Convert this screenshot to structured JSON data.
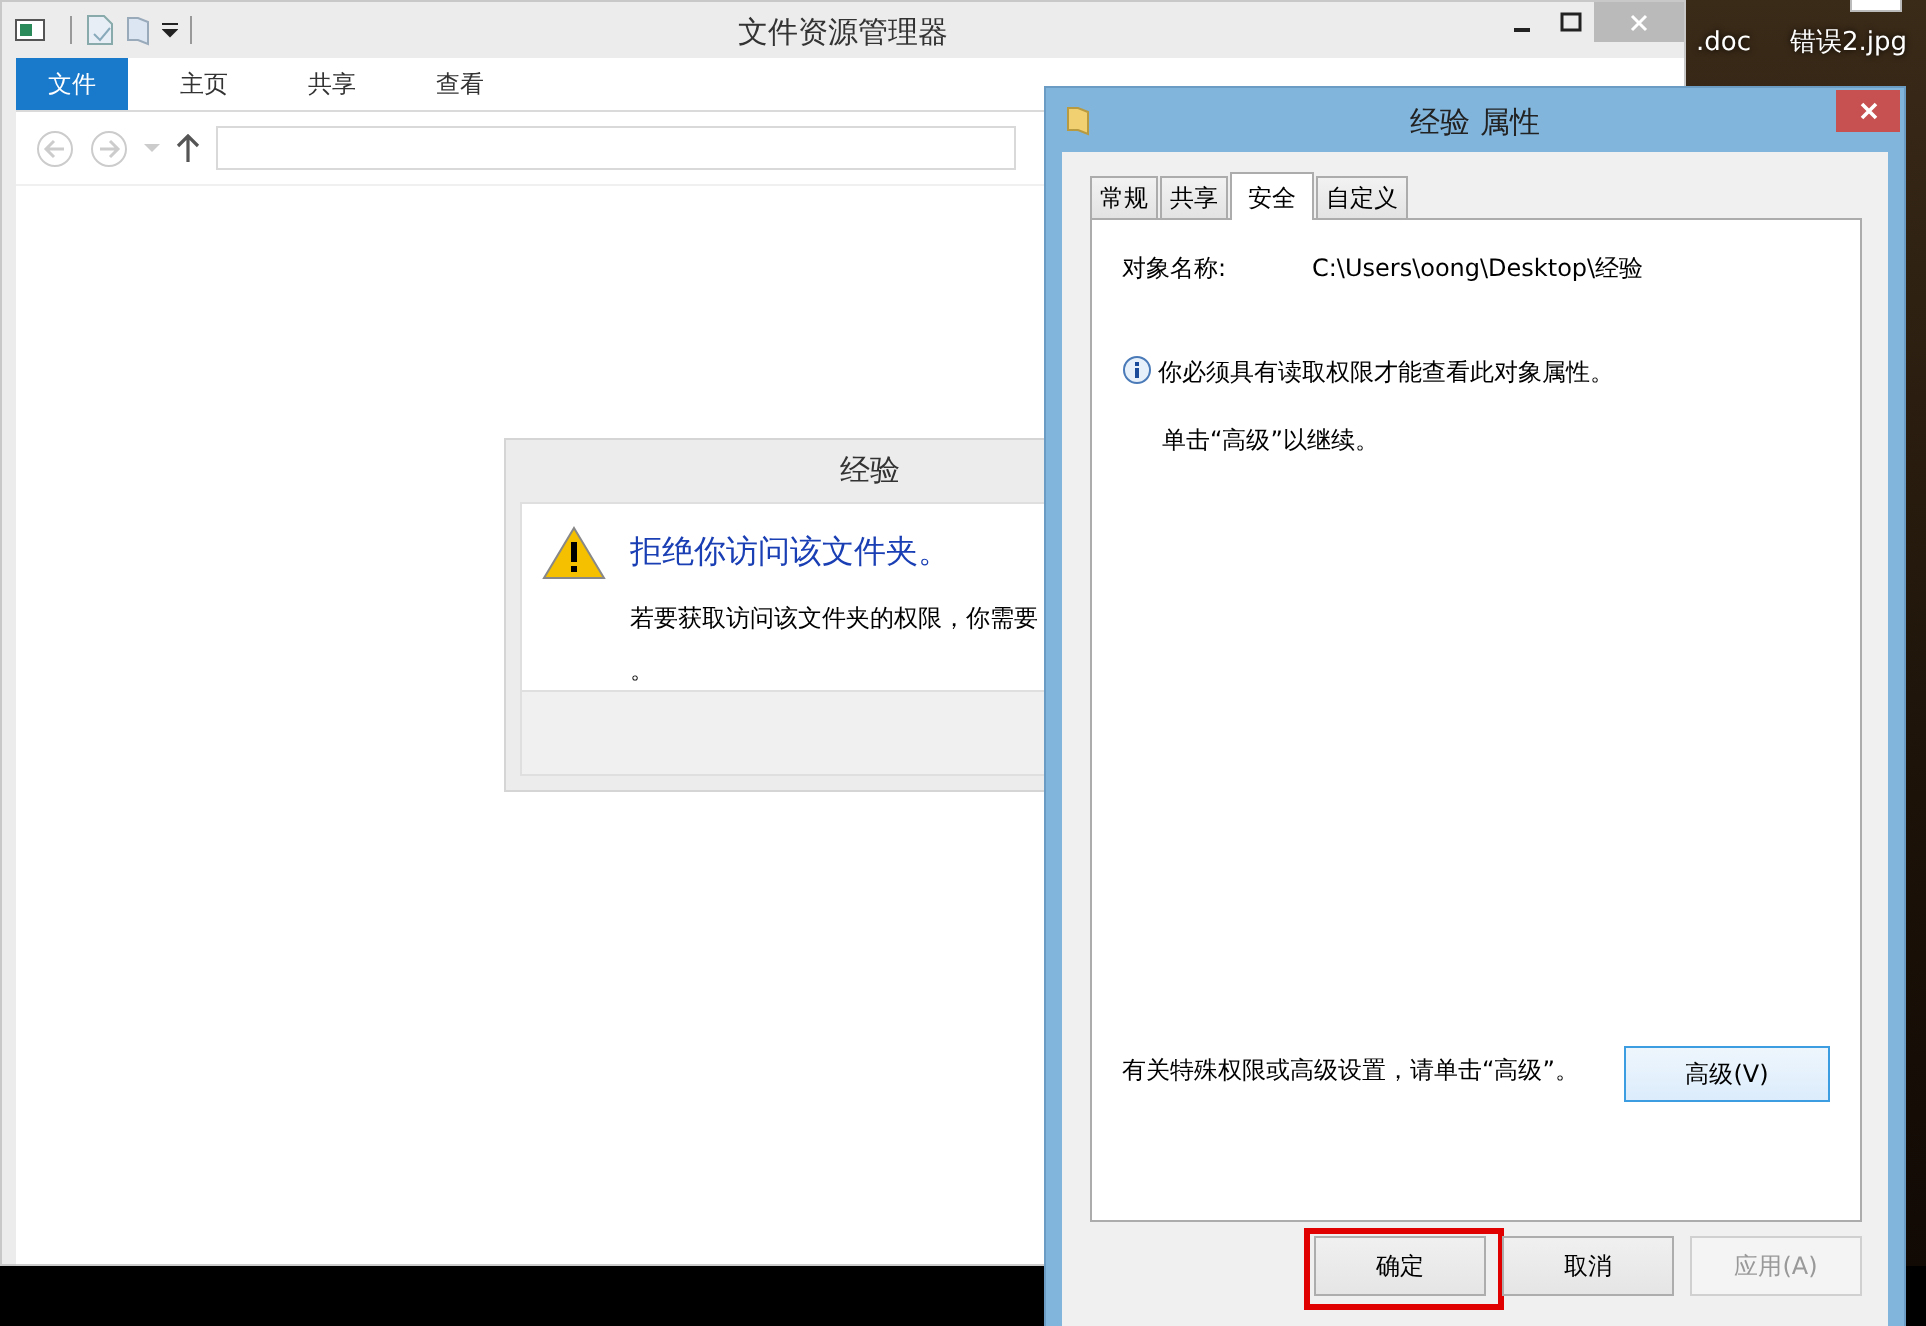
{
  "desktop_icons": [
    {
      "label": ".doc"
    },
    {
      "label": "错误2.jpg"
    }
  ],
  "explorer": {
    "title": "文件资源管理器",
    "ribbon_tabs": [
      {
        "label": "文件",
        "selected": true
      },
      {
        "label": "主页",
        "selected": false
      },
      {
        "label": "共享",
        "selected": false
      },
      {
        "label": "查看",
        "selected": false
      }
    ]
  },
  "access_dialog": {
    "title": "经验",
    "heading": "拒绝你访问该文件夹。",
    "message_lines": [
      "若要获取访问该文件夹的权限，你需要",
      "。"
    ]
  },
  "properties": {
    "title": "经验 属性",
    "tabs": [
      {
        "label": "常规",
        "selected": false
      },
      {
        "label": "共享",
        "selected": false
      },
      {
        "label": "安全",
        "selected": true
      },
      {
        "label": "自定义",
        "selected": false
      }
    ],
    "object_label": "对象名称:",
    "object_path": "C:\\Users\\oong\\Desktop\\经验",
    "info": "你必须具有读取权限才能查看此对象属性。",
    "hint": "单击“高级”以继续。",
    "advanced_text": "有关特殊权限或高级设置，请单击“高级”。",
    "advanced_button": "高级(V)",
    "buttons": [
      {
        "label": "确定",
        "disabled": false,
        "highlighted": true
      },
      {
        "label": "取消",
        "disabled": false,
        "highlighted": false
      },
      {
        "label": "应用(A)",
        "disabled": true,
        "highlighted": false
      }
    ]
  }
}
